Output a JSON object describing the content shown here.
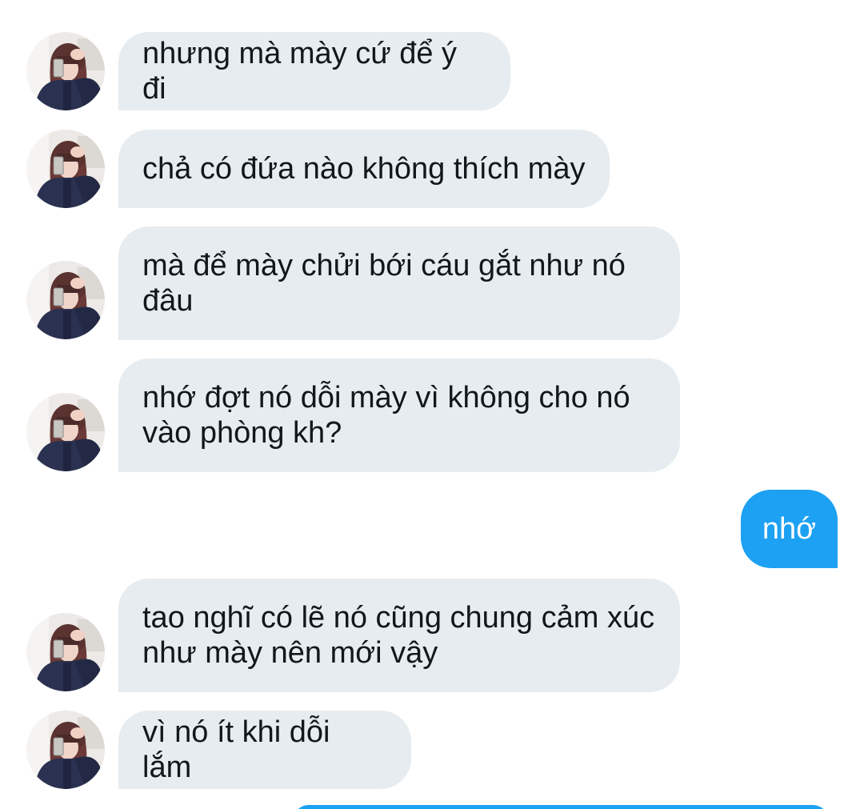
{
  "conversation": {
    "messages": [
      {
        "direction": "incoming",
        "text": "nhưng mà mày cứ để ý đi"
      },
      {
        "direction": "incoming",
        "text": "chả có đứa nào không thích mày"
      },
      {
        "direction": "incoming",
        "text": "mà để mày chửi bới cáu gắt như nó đâu"
      },
      {
        "direction": "incoming",
        "text": "nhớ đợt nó dỗi mày vì không cho nó vào phòng kh?"
      },
      {
        "direction": "outgoing",
        "text": "nhớ"
      },
      {
        "direction": "incoming",
        "text": "tao nghĩ có lẽ nó cũng chung cảm xúc như mày nên mới vậy"
      },
      {
        "direction": "incoming",
        "text": "vì nó ít khi dỗi lắm"
      }
    ]
  },
  "colors": {
    "incoming_bubble": "#e6ecf0",
    "outgoing_bubble": "#1da1f2",
    "incoming_text": "#14171a",
    "outgoing_text": "#ffffff"
  },
  "icons": {
    "avatar": "user-avatar-photo"
  }
}
